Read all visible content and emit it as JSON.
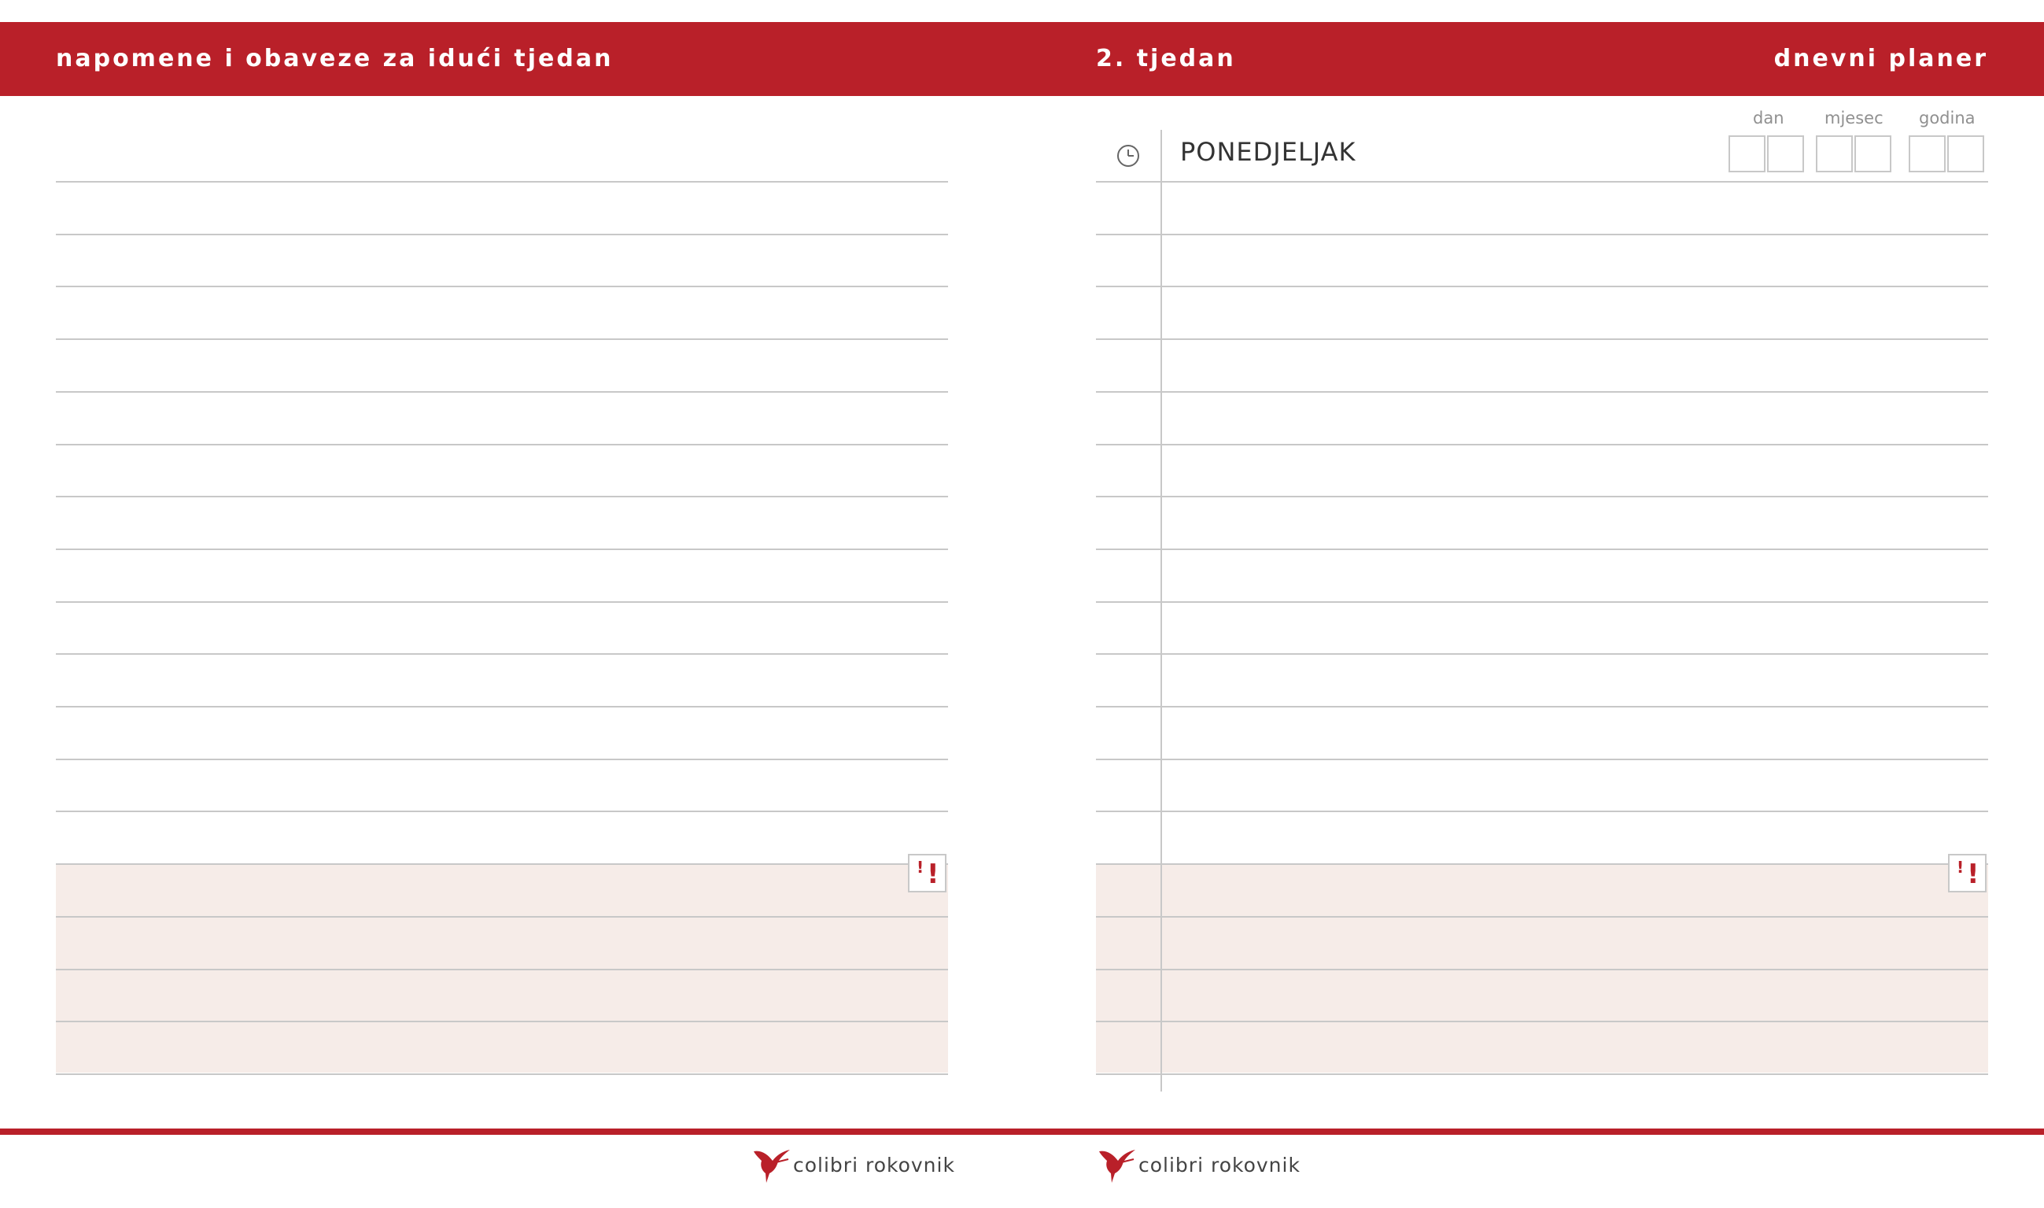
{
  "header": {
    "left_title": "napomene i obaveze za idući tjedan",
    "week": "2. tjedan",
    "right_title": "dnevni planer"
  },
  "day": {
    "name": "PONEDJELJAK",
    "date_labels": {
      "day": "dan",
      "month": "mjesec",
      "year": "godina"
    }
  },
  "priority_mark": {
    "small": "!",
    "big": "!"
  },
  "footer": {
    "brand": "colibri rokovnik"
  },
  "colors": {
    "accent": "#b92029",
    "rule": "#c8c8c8",
    "band": "#f6ece8"
  },
  "icons": {
    "time": "clock-icon",
    "brand": "hummingbird-logo-icon"
  }
}
